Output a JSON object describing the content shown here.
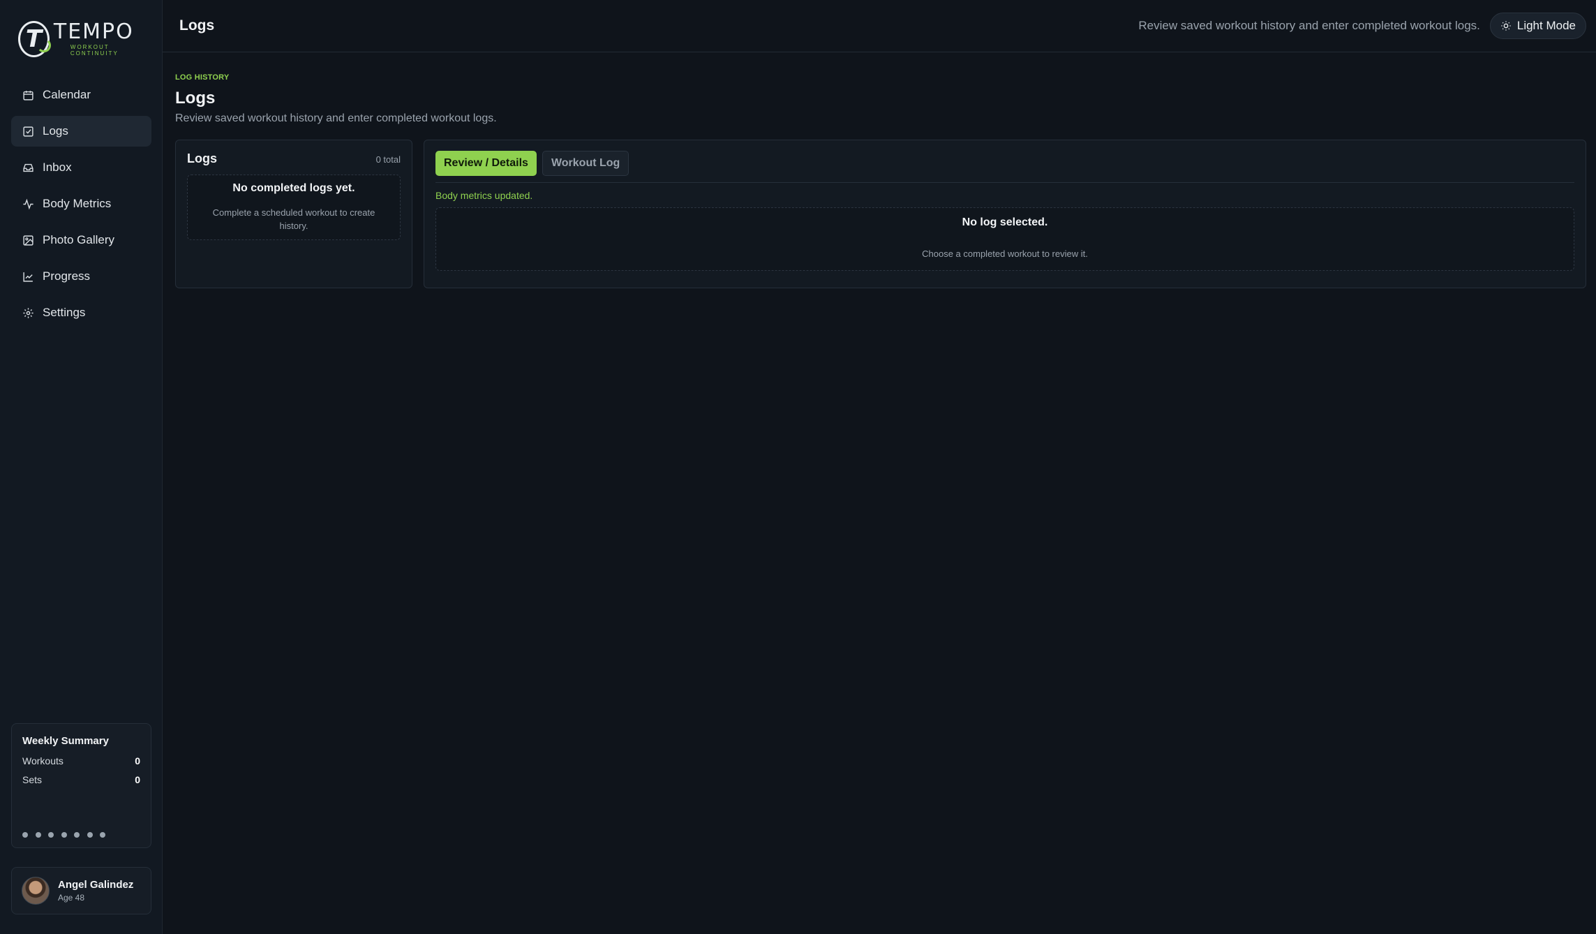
{
  "brand": {
    "name": "TEMPO",
    "tagline": "WORKOUT CONTINUITY",
    "accent": "#8fd14f"
  },
  "sidebar": {
    "items": [
      {
        "label": "Calendar",
        "icon": "calendar-icon",
        "active": false
      },
      {
        "label": "Logs",
        "icon": "checklist-icon",
        "active": true
      },
      {
        "label": "Inbox",
        "icon": "inbox-icon",
        "active": false
      },
      {
        "label": "Body Metrics",
        "icon": "activity-icon",
        "active": false
      },
      {
        "label": "Photo Gallery",
        "icon": "image-icon",
        "active": false
      },
      {
        "label": "Progress",
        "icon": "chart-line-icon",
        "active": false
      },
      {
        "label": "Settings",
        "icon": "gear-icon",
        "active": false
      }
    ]
  },
  "weekly_summary": {
    "title": "Weekly Summary",
    "rows": [
      {
        "label": "Workouts",
        "value": "0"
      },
      {
        "label": "Sets",
        "value": "0"
      }
    ],
    "day_dots": 7
  },
  "user": {
    "name": "Angel Galindez",
    "age": "Age 48"
  },
  "topbar": {
    "title": "Logs",
    "subtitle": "Review saved workout history and enter completed workout logs.",
    "mode_button": "Light Mode"
  },
  "page": {
    "eyebrow": "LOG HISTORY",
    "title": "Logs",
    "subtitle": "Review saved workout history and enter completed workout logs."
  },
  "logs_panel": {
    "title": "Logs",
    "count": "0 total",
    "empty_title": "No completed logs yet.",
    "empty_text": "Complete a scheduled workout to create history."
  },
  "detail_panel": {
    "tabs": [
      {
        "label": "Review / Details",
        "active": true
      },
      {
        "label": "Workout Log",
        "active": false
      }
    ],
    "notice": "Body metrics updated.",
    "empty_title": "No log selected.",
    "empty_text": "Choose a completed workout to review it."
  }
}
